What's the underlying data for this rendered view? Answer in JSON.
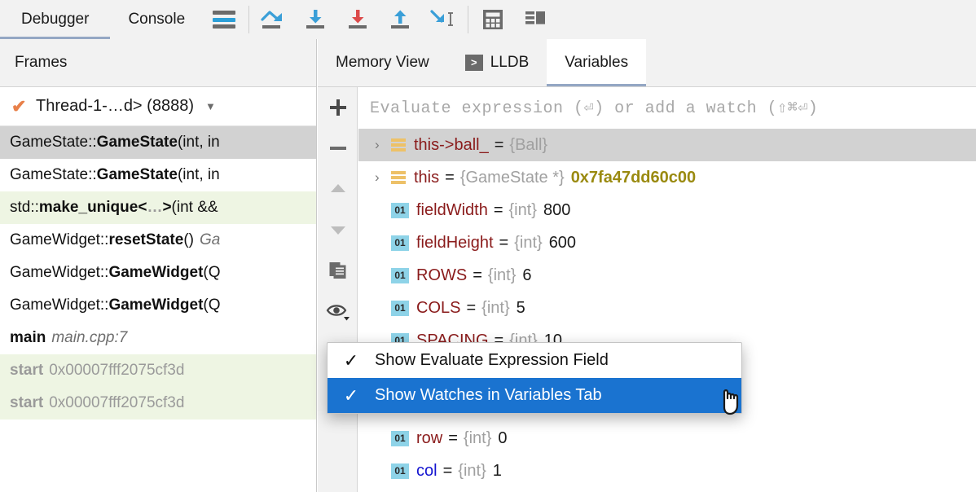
{
  "toolbar": {
    "tabs": [
      {
        "label": "Debugger",
        "active": true
      },
      {
        "label": "Console",
        "active": false
      }
    ],
    "buttons": [
      {
        "name": "frames-layout-button",
        "icon": "hamburger-icon",
        "label": ""
      },
      {
        "name": "step-over-button",
        "icon": "step-over-icon",
        "label": ""
      },
      {
        "name": "step-into-button",
        "icon": "step-into-icon",
        "label": ""
      },
      {
        "name": "force-step-into-button",
        "icon": "force-step-into-icon",
        "label": ""
      },
      {
        "name": "step-out-button",
        "icon": "step-out-icon",
        "label": ""
      },
      {
        "name": "run-to-cursor-button",
        "icon": "run-to-cursor-icon",
        "label": ""
      },
      {
        "name": "evaluate-expression-button",
        "icon": "calculator-icon",
        "label": ""
      },
      {
        "name": "layout-settings-button",
        "icon": "layout-icon",
        "label": ""
      }
    ]
  },
  "frames": {
    "header": "Frames",
    "thread": {
      "label": "Thread-1-…d> (8888)",
      "status_icon": "checkmark-icon",
      "dropdown_icon": "chevron-down-icon"
    },
    "rows": [
      {
        "pre": "GameState::",
        "bold": "GameState",
        "post": "(int, in",
        "loc": "",
        "addr": "",
        "style": "selected"
      },
      {
        "pre": "GameState::",
        "bold": "GameState",
        "post": "(int, in",
        "loc": "",
        "addr": "",
        "style": "plain"
      },
      {
        "pre": "std::",
        "bold": "make_unique<…>",
        "post": "(int &&",
        "loc": "",
        "addr": "",
        "style": "lib"
      },
      {
        "pre": "GameWidget::",
        "bold": "resetState",
        "post": "()",
        "loc": "Ga",
        "addr": "",
        "style": "plain"
      },
      {
        "pre": "GameWidget::",
        "bold": "GameWidget",
        "post": "(Q",
        "loc": "",
        "addr": "",
        "style": "plain"
      },
      {
        "pre": "GameWidget::",
        "bold": "GameWidget",
        "post": "(Q",
        "loc": "",
        "addr": "",
        "style": "plain"
      },
      {
        "pre": "",
        "bold": "main",
        "post": "",
        "loc": "main.cpp:7",
        "addr": "",
        "style": "plain"
      },
      {
        "pre": "",
        "bold": "start",
        "post": "",
        "loc": "",
        "addr": "0x00007fff2075cf3d",
        "style": "lib-dim"
      },
      {
        "pre": "",
        "bold": "start",
        "post": "",
        "loc": "",
        "addr": "0x00007fff2075cf3d",
        "style": "lib-dim"
      }
    ]
  },
  "variables_panel": {
    "tabs": [
      {
        "label": "Memory View",
        "active": false,
        "icon": ""
      },
      {
        "label": "LLDB",
        "active": false,
        "icon": "console-icon"
      },
      {
        "label": "Variables",
        "active": true,
        "icon": ""
      }
    ],
    "gutter_buttons": [
      {
        "name": "add-watch-button",
        "icon": "plus-icon"
      },
      {
        "name": "remove-watch-button",
        "icon": "minus-icon"
      },
      {
        "name": "move-watch-up-button",
        "icon": "arrow-up-icon"
      },
      {
        "name": "move-watch-down-button",
        "icon": "arrow-down-icon"
      },
      {
        "name": "copy-watch-button",
        "icon": "copy-icon"
      },
      {
        "name": "view-options-button",
        "icon": "eye-icon"
      }
    ],
    "evaluate_placeholder": "Evaluate expression (⏎) or add a watch (⇧⌘⏎)",
    "rows": [
      {
        "twisty": "›",
        "icon": "object-icon",
        "name": "this->ball_",
        "type": "{Ball}",
        "value": "",
        "value_kind": "braced",
        "selected": true,
        "changed": false
      },
      {
        "twisty": "›",
        "icon": "object-icon",
        "name": "this",
        "type": "{GameState *}",
        "value": "0x7fa47dd60c00",
        "value_kind": "ptr",
        "selected": false,
        "changed": false
      },
      {
        "twisty": "",
        "icon": "number-icon",
        "name": "fieldWidth",
        "type": "{int}",
        "value": "800",
        "value_kind": "plain",
        "selected": false,
        "changed": false
      },
      {
        "twisty": "",
        "icon": "number-icon",
        "name": "fieldHeight",
        "type": "{int}",
        "value": "600",
        "value_kind": "plain",
        "selected": false,
        "changed": false
      },
      {
        "twisty": "",
        "icon": "number-icon",
        "name": "ROWS",
        "type": "{int}",
        "value": "6",
        "value_kind": "plain",
        "selected": false,
        "changed": false
      },
      {
        "twisty": "",
        "icon": "number-icon",
        "name": "COLS",
        "type": "{int}",
        "value": "5",
        "value_kind": "plain",
        "selected": false,
        "changed": false
      },
      {
        "twisty": "",
        "icon": "number-icon",
        "name": "SPACING",
        "type": "{int}",
        "value": "10",
        "value_kind": "plain",
        "selected": false,
        "changed": false
      },
      {
        "twisty": "",
        "icon": "number-icon",
        "name": "",
        "type": "",
        "value": "",
        "value_kind": "plain",
        "selected": false,
        "changed": false
      },
      {
        "twisty": "",
        "icon": "number-icon",
        "name": "",
        "type": "",
        "value": "",
        "value_kind": "plain",
        "selected": false,
        "changed": false
      },
      {
        "twisty": "",
        "icon": "number-icon",
        "name": "row",
        "type": "{int}",
        "value": "0",
        "value_kind": "plain",
        "selected": false,
        "changed": false
      },
      {
        "twisty": "",
        "icon": "number-icon",
        "name": "col",
        "type": "{int}",
        "value": "1",
        "value_kind": "plain",
        "selected": false,
        "changed": true
      }
    ]
  },
  "popup_menu": {
    "items": [
      {
        "label": "Show Evaluate Expression Field",
        "checked": true,
        "highlighted": false
      },
      {
        "label": "Show Watches in Variables Tab",
        "checked": true,
        "highlighted": true
      }
    ],
    "check_glyph": "✓",
    "highlight_color": "#1a73d0"
  }
}
